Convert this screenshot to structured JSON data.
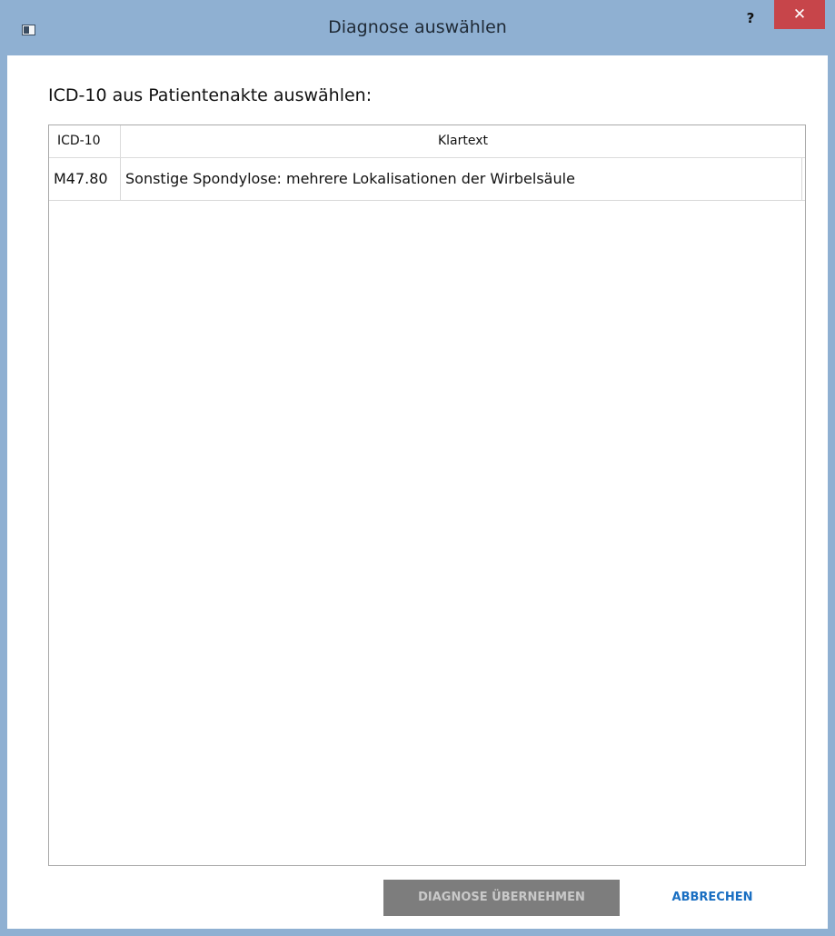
{
  "window": {
    "title": "Diagnose auswählen",
    "help_label": "?",
    "close_label": "✕"
  },
  "dialog": {
    "instruction": "ICD-10 aus Patientenakte auswählen:"
  },
  "table": {
    "columns": [
      "ICD-10",
      "Klartext"
    ],
    "rows": [
      {
        "icd": "M47.80",
        "klartext": "Sonstige Spondylose: mehrere Lokalisationen der Wirbelsäule"
      }
    ]
  },
  "buttons": {
    "accept_label": "DIAGNOSE ÜBERNEHMEN",
    "accept_enabled": false,
    "cancel_label": "ABBRECHEN"
  },
  "colors": {
    "titlebar": "#8fb0d2",
    "close_button": "#c7454a",
    "disabled_button": "#7d7d7d",
    "link_blue": "#1a6fc2"
  }
}
